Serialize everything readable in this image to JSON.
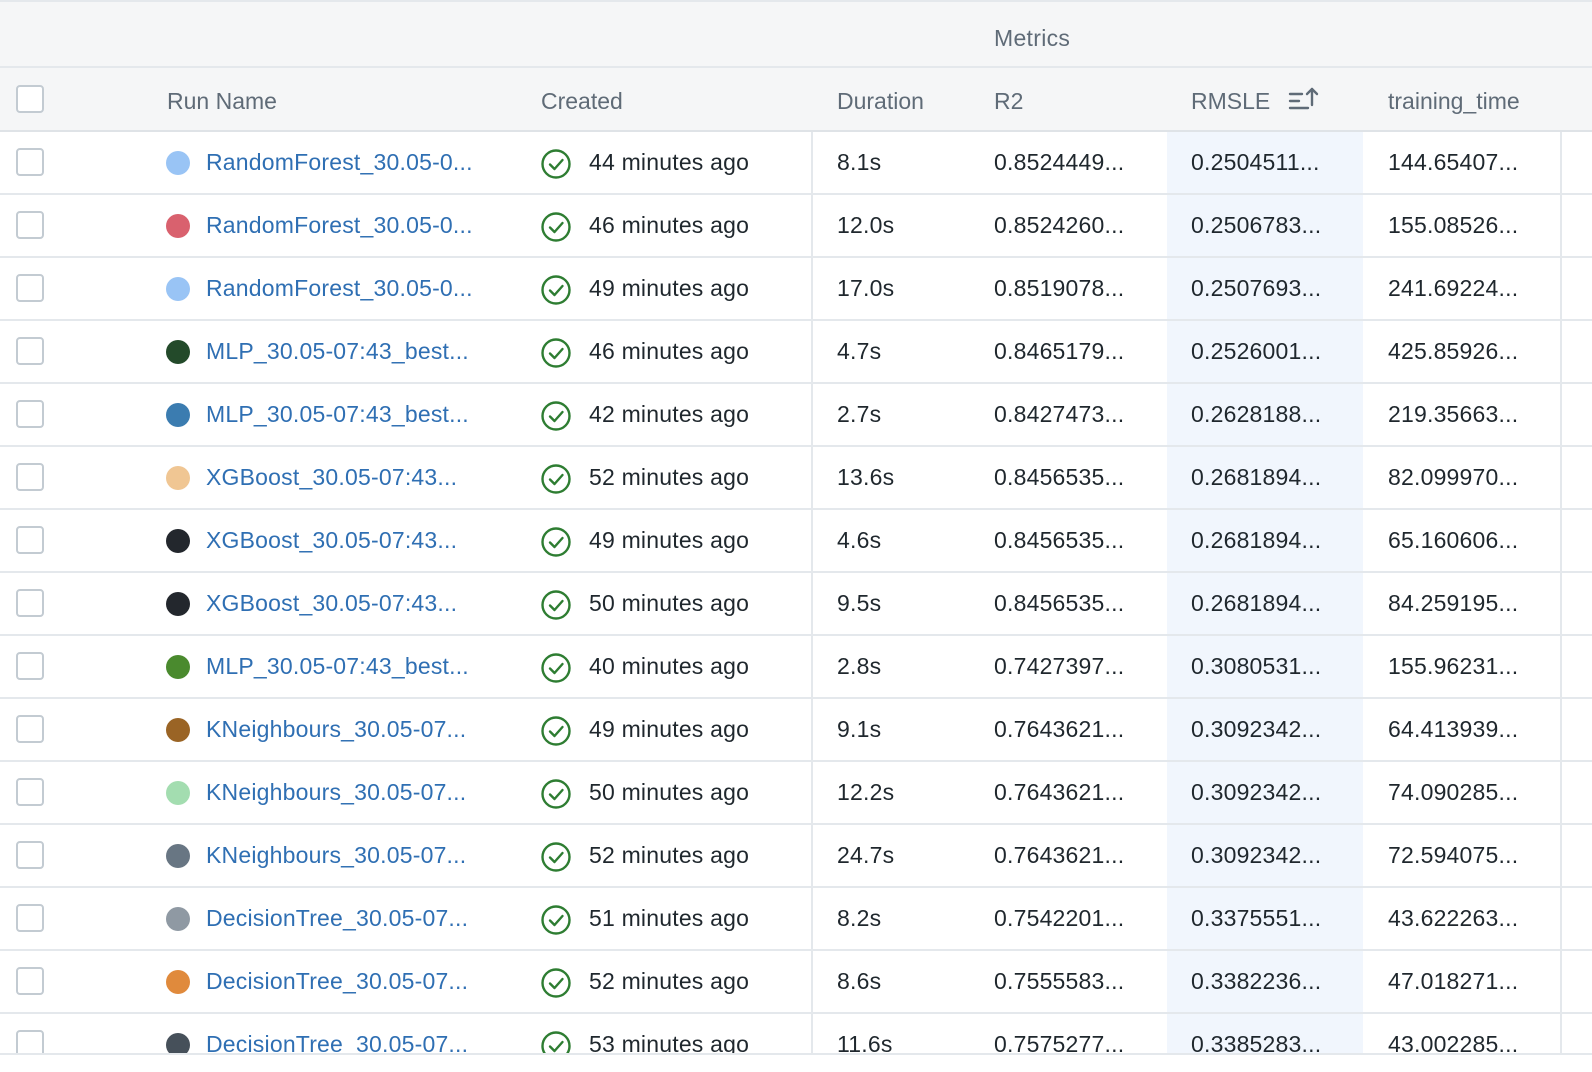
{
  "table": {
    "group_header": "Metrics",
    "columns": {
      "run_name": "Run Name",
      "created": "Created",
      "duration": "Duration",
      "r2": "R2",
      "rmsle": "RMSLE",
      "training_time": "training_time"
    },
    "sorted_column": "RMSLE",
    "sort_direction": "ascending",
    "status_color": "#2e7d32",
    "link_color": "#2f6fb3",
    "rows": [
      {
        "run_name": "RandomForest_30.05-0...",
        "color": "#99c4f5",
        "created": "44 minutes ago",
        "duration": "8.1s",
        "r2": "0.8524449...",
        "rmsle": "0.2504511...",
        "training_time": "144.65407..."
      },
      {
        "run_name": "RandomForest_30.05-0...",
        "color": "#d9616e",
        "created": "46 minutes ago",
        "duration": "12.0s",
        "r2": "0.8524260...",
        "rmsle": "0.2506783...",
        "training_time": "155.08526..."
      },
      {
        "run_name": "RandomForest_30.05-0...",
        "color": "#99c4f5",
        "created": "49 minutes ago",
        "duration": "17.0s",
        "r2": "0.8519078...",
        "rmsle": "0.2507693...",
        "training_time": "241.69224..."
      },
      {
        "run_name": "MLP_30.05-07:43_best...",
        "color": "#234a2a",
        "created": "46 minutes ago",
        "duration": "4.7s",
        "r2": "0.8465179...",
        "rmsle": "0.2526001...",
        "training_time": "425.85926..."
      },
      {
        "run_name": "MLP_30.05-07:43_best...",
        "color": "#3b7cb0",
        "created": "42 minutes ago",
        "duration": "2.7s",
        "r2": "0.8427473...",
        "rmsle": "0.2628188...",
        "training_time": "219.35663..."
      },
      {
        "run_name": "XGBoost_30.05-07:43...",
        "color": "#f0c693",
        "created": "52 minutes ago",
        "duration": "13.6s",
        "r2": "0.8456535...",
        "rmsle": "0.2681894...",
        "training_time": "82.099970..."
      },
      {
        "run_name": "XGBoost_30.05-07:43...",
        "color": "#23272d",
        "created": "49 minutes ago",
        "duration": "4.6s",
        "r2": "0.8456535...",
        "rmsle": "0.2681894...",
        "training_time": "65.160606..."
      },
      {
        "run_name": "XGBoost_30.05-07:43...",
        "color": "#23272d",
        "created": "50 minutes ago",
        "duration": "9.5s",
        "r2": "0.8456535...",
        "rmsle": "0.2681894...",
        "training_time": "84.259195..."
      },
      {
        "run_name": "MLP_30.05-07:43_best...",
        "color": "#4a8a2e",
        "created": "40 minutes ago",
        "duration": "2.8s",
        "r2": "0.7427397...",
        "rmsle": "0.3080531...",
        "training_time": "155.96231..."
      },
      {
        "run_name": "KNeighbours_30.05-07...",
        "color": "#9a6425",
        "created": "49 minutes ago",
        "duration": "9.1s",
        "r2": "0.7643621...",
        "rmsle": "0.3092342...",
        "training_time": "64.413939..."
      },
      {
        "run_name": "KNeighbours_30.05-07...",
        "color": "#a3ddb0",
        "created": "50 minutes ago",
        "duration": "12.2s",
        "r2": "0.7643621...",
        "rmsle": "0.3092342...",
        "training_time": "74.090285..."
      },
      {
        "run_name": "KNeighbours_30.05-07...",
        "color": "#687683",
        "created": "52 minutes ago",
        "duration": "24.7s",
        "r2": "0.7643621...",
        "rmsle": "0.3092342...",
        "training_time": "72.594075..."
      },
      {
        "run_name": "DecisionTree_30.05-07...",
        "color": "#8f99a3",
        "created": "51 minutes ago",
        "duration": "8.2s",
        "r2": "0.7542201...",
        "rmsle": "0.3375551...",
        "training_time": "43.622263..."
      },
      {
        "run_name": "DecisionTree_30.05-07...",
        "color": "#e08a3c",
        "created": "52 minutes ago",
        "duration": "8.6s",
        "r2": "0.7555583...",
        "rmsle": "0.3382236...",
        "training_time": "47.018271..."
      },
      {
        "run_name": "DecisionTree_30.05-07...",
        "color": "#46505a",
        "created": "53 minutes ago",
        "duration": "11.6s",
        "r2": "0.7575277...",
        "rmsle": "0.3385283...",
        "training_time": "43.002285..."
      }
    ]
  },
  "icons": {
    "status": "check-circle-icon",
    "sort": "sort-ascending-icon"
  }
}
